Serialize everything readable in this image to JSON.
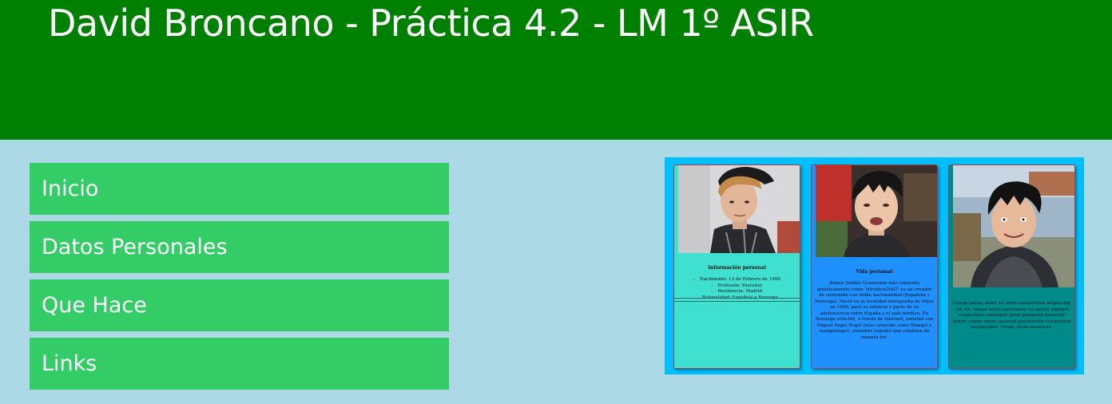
{
  "header": {
    "title": "David Broncano - Práctica 4.2 - LM 1º ASIR"
  },
  "nav": {
    "items": [
      {
        "label": "Inicio"
      },
      {
        "label": "Datos Personales"
      },
      {
        "label": "Que Hace"
      },
      {
        "label": "Links"
      }
    ]
  },
  "gallery": {
    "cards": [
      {
        "title": "Información personal",
        "items": [
          "Nacimiento: 13 de Febrero de 1990",
          "Profesión: Youtuber",
          "Residencia: Madrid",
          "Ncionalidad: Española y Noruega"
        ]
      },
      {
        "title": "Vida personal",
        "text": "Ruben Doblás Gundersen más conocido artísticamente como \"elrubiusOMG\" es un creador de contenido con doble nacionalidad (Española y Noruega). Nació en la localidad malagueña de Mijas en 1990, pasó su infancia y parte de su adolescencia entre España y el país nórdico. En Noruega enta-bló, a través de Internet, amistad con Miguel Ángel Rogel (más conocido como Mangel o mangelrogel), youtuber español que colabora de manera fre-"
      },
      {
        "text": "Lorem ipsum, dolor sit amet consectetur adipisicing elit. Ex, neque nobis aspernatur ex autem eligendi consectetur similique quod quisquam deserunt labore eaque nemo, quaerat preferendis voluptatem perspiciatis! Totam, illum inventore."
      }
    ]
  },
  "colors": {
    "header_bg": "#008000",
    "page_bg": "#add8e6",
    "nav_bg": "#33cc66",
    "gallery_bg": "#00bfff",
    "card1_bg": "#40e0d0",
    "card2_bg": "#1e90ff",
    "card3_bg": "#008b8b"
  }
}
